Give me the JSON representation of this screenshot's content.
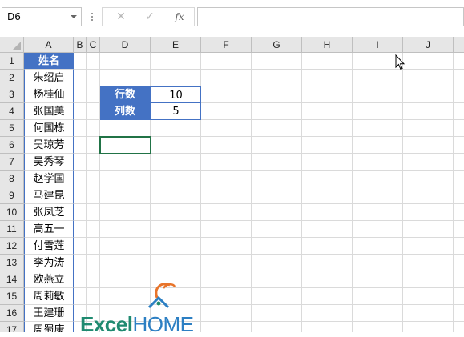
{
  "formula_bar": {
    "name_box": "D6",
    "cancel_icon": "✕",
    "enter_icon": "✓",
    "fx_label": "fx",
    "formula": ""
  },
  "columns": [
    "A",
    "B",
    "C",
    "D",
    "E",
    "F",
    "G",
    "H",
    "I",
    "J"
  ],
  "rows": [
    "1",
    "2",
    "3",
    "4",
    "5",
    "6",
    "7",
    "8",
    "9",
    "10",
    "11",
    "12",
    "13",
    "14",
    "15",
    "16",
    "17"
  ],
  "names": {
    "header": "姓名",
    "list": [
      "朱绍启",
      "杨桂仙",
      "张国美",
      "何国栋",
      "吴琼芳",
      "吴秀琴",
      "赵学国",
      "马建昆",
      "张凤芝",
      "高五一",
      "付雪莲",
      "李为涛",
      "欧燕立",
      "周莉敏",
      "王建珊",
      "周蜀康"
    ]
  },
  "params": {
    "rows_label": "行数",
    "rows_value": "10",
    "cols_label": "列数",
    "cols_value": "5"
  },
  "logo": {
    "excel": "Excel",
    "home": "HOME"
  },
  "colors": {
    "header_fill": "#4472c4",
    "selection": "#217346",
    "logo_green": "#1f8a70",
    "logo_blue": "#2c7fc3",
    "logo_orange": "#e8742a"
  }
}
